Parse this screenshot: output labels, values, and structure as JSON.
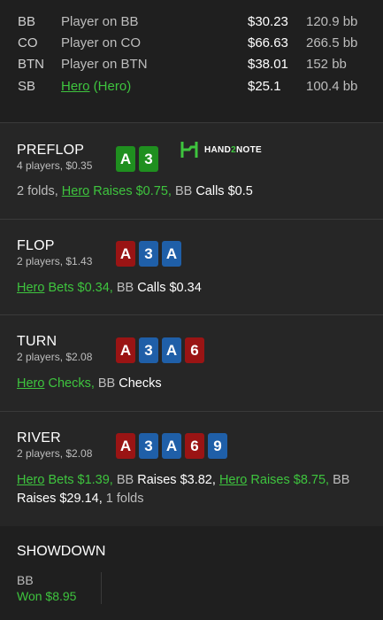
{
  "players": [
    {
      "pos": "BB",
      "name": "Player on BB",
      "stack": "$30.23",
      "bb": "120.9 bb",
      "hero": false
    },
    {
      "pos": "CO",
      "name": "Player on CO",
      "stack": "$66.63",
      "bb": "266.5 bb",
      "hero": false
    },
    {
      "pos": "BTN",
      "name": "Player on BTN",
      "stack": "$38.01",
      "bb": "152 bb",
      "hero": false
    },
    {
      "pos": "SB",
      "name_link": "Hero",
      "name_suffix": " (Hero)",
      "stack": "$25.1",
      "bb": "100.4 bb",
      "hero": true
    }
  ],
  "logo": {
    "text_a": "HAND",
    "text_b": "2",
    "text_c": "NOTE"
  },
  "preflop": {
    "title": "PREFLOP",
    "sub": "4 players, $0.35",
    "cards": [
      {
        "rank": "A",
        "color": "green"
      },
      {
        "rank": "3",
        "color": "green"
      }
    ],
    "a1": "2 folds, ",
    "a2": "Hero",
    "a3": " Raises $0.75, ",
    "a4": "BB",
    "a5": " Calls $0.5"
  },
  "flop": {
    "title": "FLOP",
    "sub": "2 players, $1.43",
    "cards": [
      {
        "rank": "A",
        "color": "red"
      },
      {
        "rank": "3",
        "color": "blue"
      },
      {
        "rank": "A",
        "color": "blue"
      }
    ],
    "a1": "Hero",
    "a2": " Bets $0.34, ",
    "a3": "BB",
    "a4": " Calls $0.34"
  },
  "turn": {
    "title": "TURN",
    "sub": "2 players, $2.08",
    "cards": [
      {
        "rank": "A",
        "color": "red"
      },
      {
        "rank": "3",
        "color": "blue"
      },
      {
        "rank": "A",
        "color": "blue"
      },
      {
        "rank": "6",
        "color": "red"
      }
    ],
    "a1": "Hero",
    "a2": " Checks, ",
    "a3": "BB",
    "a4": " Checks"
  },
  "river": {
    "title": "RIVER",
    "sub": "2 players, $2.08",
    "cards": [
      {
        "rank": "A",
        "color": "red"
      },
      {
        "rank": "3",
        "color": "blue"
      },
      {
        "rank": "A",
        "color": "blue"
      },
      {
        "rank": "6",
        "color": "red"
      },
      {
        "rank": "9",
        "color": "blue"
      }
    ],
    "a1": "Hero",
    "a2": " Bets $1.39, ",
    "a3": "BB",
    "a4": " Raises $3.82, ",
    "a5": "Hero",
    "a6": " Raises $8.75, ",
    "a7": "BB",
    "a8": " Raises $29.14, ",
    "a9": "1 folds"
  },
  "showdown": {
    "title": "SHOWDOWN",
    "winner_pos": "BB",
    "winner_text": "Won $8.95"
  },
  "colors": {
    "hero_green": "#3ec43e",
    "card_red": "#9a1414",
    "card_blue": "#1f5fa8",
    "card_green": "#1f8f1f"
  }
}
